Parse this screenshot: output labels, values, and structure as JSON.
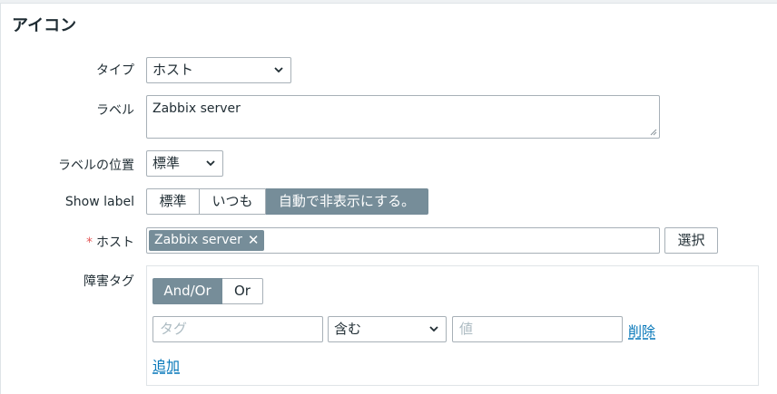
{
  "title": "アイコン",
  "fields": {
    "type": {
      "label": "タイプ",
      "value": "ホスト"
    },
    "label": {
      "label": "ラベル",
      "value": "Zabbix server"
    },
    "label_position": {
      "label": "ラベルの位置",
      "value": "標準"
    },
    "show_label": {
      "label": "Show label",
      "options": [
        "標準",
        "いつも",
        "自動で非表示にする。"
      ],
      "selected": "自動で非表示にする。"
    },
    "host": {
      "required_mark": "*",
      "label": "ホスト",
      "chip": "Zabbix server",
      "chip_remove": "✕",
      "select_button": "選択"
    },
    "problem_tags": {
      "label": "障害タグ",
      "eval_options": [
        "And/Or",
        "Or"
      ],
      "eval_selected": "And/Or",
      "tag_placeholder": "タグ",
      "operator_value": "含む",
      "value_placeholder": "値",
      "remove_link": "削除",
      "add_link": "追加"
    }
  },
  "colors": {
    "selected_segment": "#768d99",
    "link": "#0275b8",
    "required": "#e45959"
  }
}
